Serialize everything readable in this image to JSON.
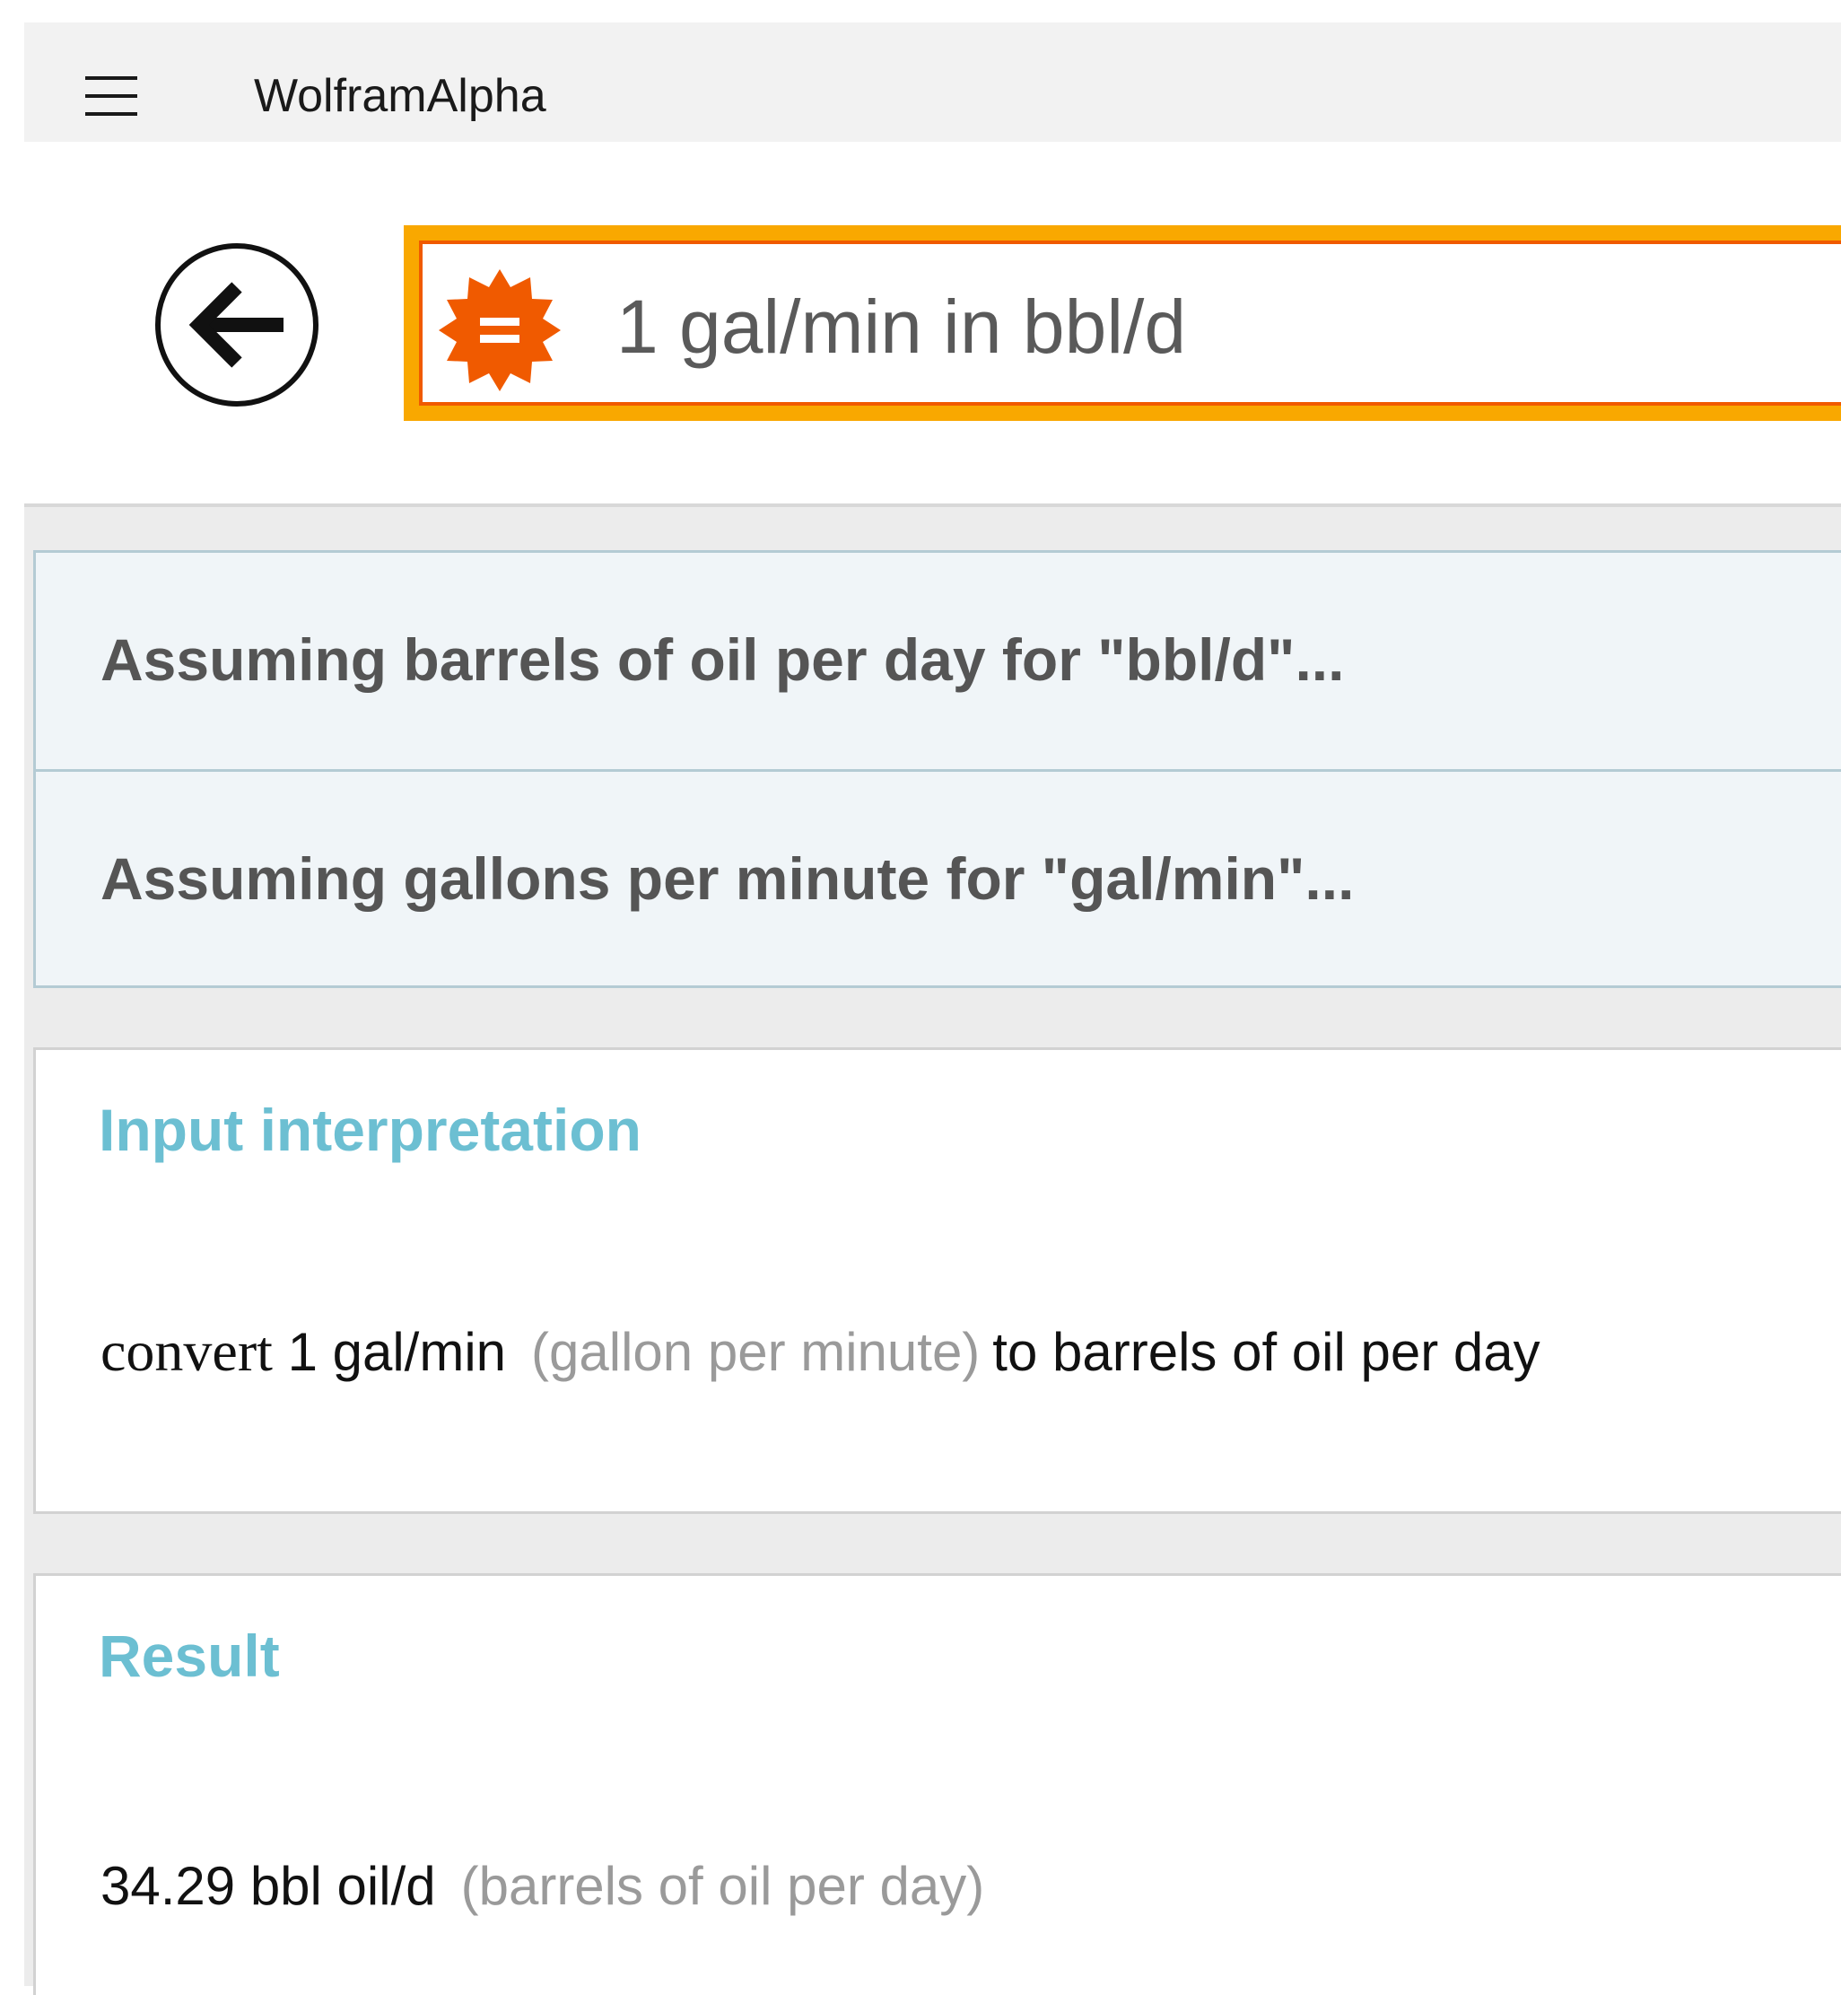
{
  "titlebar": {
    "app_title": "WolframAlpha",
    "menu_icon": "hamburger-menu-icon"
  },
  "search": {
    "back_icon": "back-arrow-icon",
    "logo_icon": "wolframalpha-logo-icon",
    "query": "1 gal/min in bbl/d"
  },
  "assumptions": [
    {
      "text": "Assuming barrels of oil per day for \"bbl/d\"..."
    },
    {
      "text": "Assuming gallons per minute for \"gal/min\"..."
    }
  ],
  "pods": {
    "input_interpretation": {
      "title": "Input interpretation",
      "convert_word": "convert",
      "quantity": "1 gal/min",
      "quantity_note": "(gallon per minute)",
      "target": "to barrels of oil per day"
    },
    "result": {
      "title": "Result",
      "value": "34.29 bbl oil/d",
      "value_note": "(barrels of oil per day)"
    }
  },
  "colors": {
    "accent_orange": "#f05a00",
    "search_border": "#f9a800",
    "pod_title": "#6cbfd2",
    "assumption_bg": "#f0f5f8"
  }
}
